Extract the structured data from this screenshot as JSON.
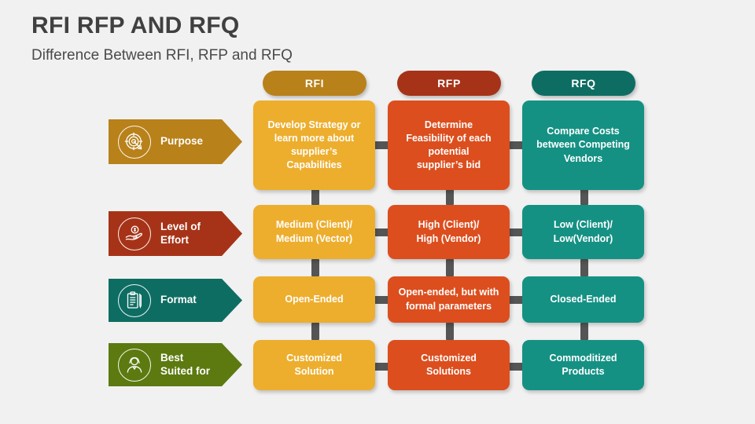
{
  "header": {
    "title": "RFI RFP AND RFQ",
    "subtitle": "Difference Between RFI, RFP and RFQ"
  },
  "colors": {
    "background": "#f1f1f1",
    "title_text": "#404040",
    "connector": "#555555",
    "rfi_header": "#b8811a",
    "rfi_cell": "#edae2e",
    "rfp_header": "#a63318",
    "rfp_cell": "#dc4e1e",
    "rfq_header": "#0e6d62",
    "rfq_cell": "#159184",
    "row_purpose": "#b8811a",
    "row_effort": "#a63318",
    "row_format": "#0e6d62",
    "row_best_suited": "#5c7a10"
  },
  "columns": [
    {
      "id": "rfi",
      "label": "RFI"
    },
    {
      "id": "rfp",
      "label": "RFP"
    },
    {
      "id": "rfq",
      "label": "RFQ"
    }
  ],
  "rows": [
    {
      "id": "purpose",
      "label": "Purpose",
      "icon": "target-icon"
    },
    {
      "id": "effort",
      "label": "Level of\nEffort",
      "icon": "hand-money-icon"
    },
    {
      "id": "format",
      "label": "Format",
      "icon": "clipboard-icon"
    },
    {
      "id": "best_suited",
      "label": "Best\nSuited for",
      "icon": "support-agent-icon"
    }
  ],
  "cells": {
    "purpose": {
      "rfi": "Develop Strategy or\nlearn more about\nsupplier’s\nCapabilities",
      "rfp": "Determine\nFeasibility of each\npotential\nsupplier’s bid",
      "rfq": "Compare Costs\nbetween Competing\nVendors"
    },
    "effort": {
      "rfi": "Medium (Client)/\nMedium (Vector)",
      "rfp": "High (Client)/\nHigh (Vendor)",
      "rfq": "Low (Client)/\nLow(Vendor)"
    },
    "format": {
      "rfi": "Open-Ended",
      "rfp": "Open-ended, but with\nformal parameters",
      "rfq": "Closed-Ended"
    },
    "best_suited": {
      "rfi": "Customized\nSolution",
      "rfp": "Customized\nSolutions",
      "rfq": "Commoditized\nProducts"
    }
  }
}
